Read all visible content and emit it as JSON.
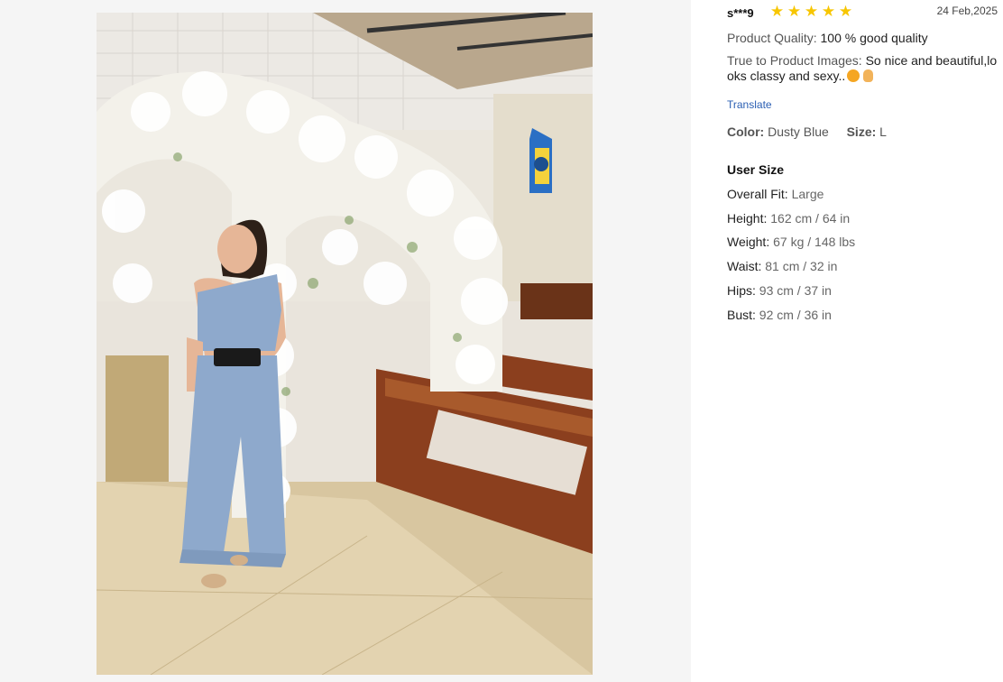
{
  "photo": {
    "alt_icon": "review-photo"
  },
  "review": {
    "user": "s***9",
    "rating": 5,
    "stars": [
      "★",
      "★",
      "★",
      "★",
      "★"
    ],
    "date": "24 Feb,2025",
    "quality_label": "Product Quality:",
    "quality_value": "100 % good quality",
    "images_label": "True to Product Images:",
    "images_value_line1": "So nice and beautiful,lo",
    "images_value_line2": "oks classy and sexy..",
    "translate": "Translate",
    "color_label": "Color:",
    "color_value": "Dusty Blue",
    "size_label": "Size:",
    "size_value": "L"
  },
  "user_size": {
    "title": "User Size",
    "rows": [
      {
        "label": "Overall Fit:",
        "value": "Large"
      },
      {
        "label": "Height:",
        "value": "162 cm / 64 in"
      },
      {
        "label": "Weight:",
        "value": "67 kg / 148 lbs"
      },
      {
        "label": "Waist:",
        "value": "81 cm / 32 in"
      },
      {
        "label": "Hips:",
        "value": "93 cm / 37 in"
      },
      {
        "label": "Bust:",
        "value": "92 cm / 36 in"
      }
    ]
  },
  "colors": {
    "star": "#f7c600",
    "link": "#2b5fb3",
    "dress": "#8ea9cc"
  }
}
